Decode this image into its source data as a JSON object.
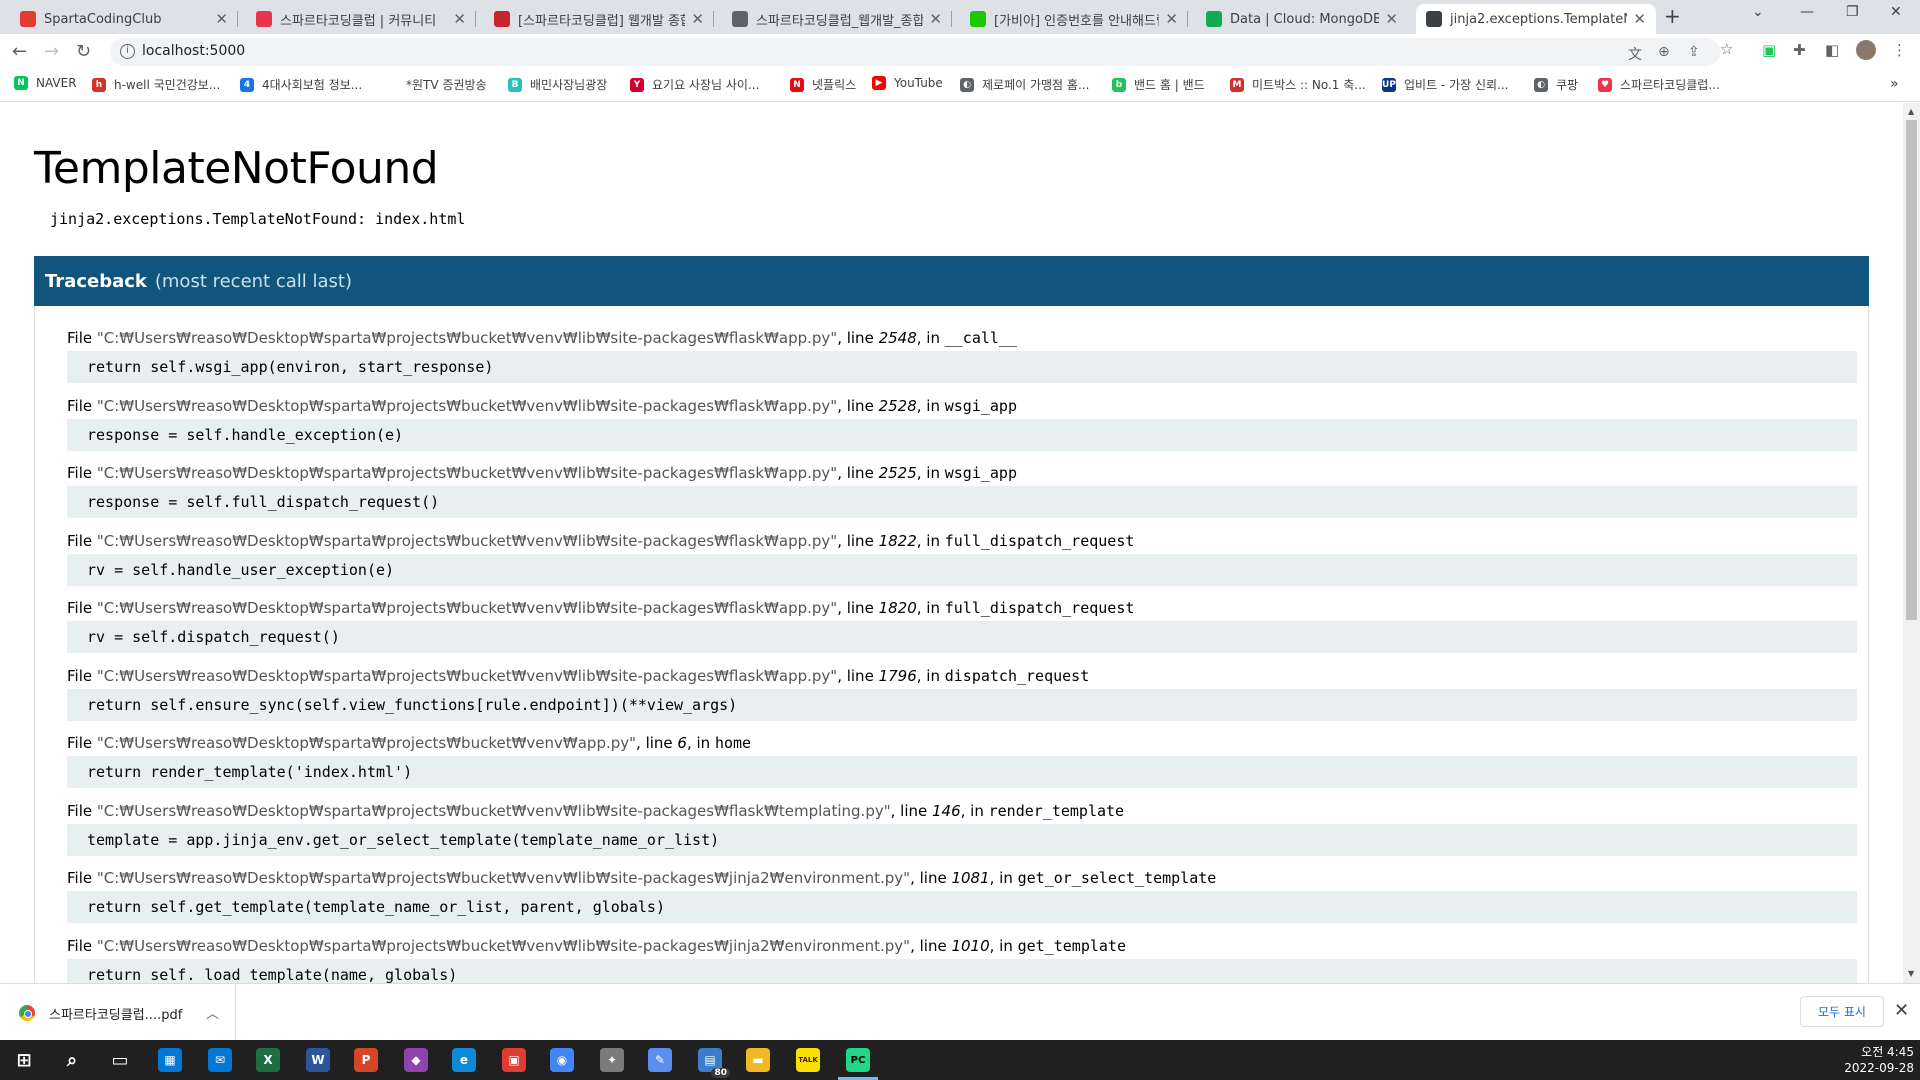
{
  "tabs": [
    {
      "label": "SpartaCodingClub",
      "favicon": "sparta-logo-icon",
      "color": "#e03c31",
      "active": false
    },
    {
      "label": "스파르타코딩클럽 | 커뮤니티",
      "favicon": "sparta-heart-icon",
      "color": "#e8344e",
      "active": false
    },
    {
      "label": "[스파르타코딩클럽] 웹개발 종합",
      "favicon": "notebook-icon",
      "color": "#c4262e",
      "active": false
    },
    {
      "label": "스파르타코딩클럽_웹개발_종합",
      "favicon": "globe-icon",
      "color": "#5f6368",
      "active": false
    },
    {
      "label": "[가비아] 인증번호를 안내해드립",
      "favicon": "mail-icon",
      "color": "#1ec800",
      "active": false
    },
    {
      "label": "Data | Cloud: MongoDB Cloud",
      "favicon": "mongodb-leaf-icon",
      "color": "#13aa52",
      "active": false
    },
    {
      "label": "jinja2.exceptions.TemplateNotF",
      "favicon": "terminal-icon",
      "color": "#3c4043",
      "active": true
    }
  ],
  "toolbar": {
    "url": "localhost:5000"
  },
  "bookmarks": [
    {
      "label": "NAVER",
      "icon": "naver-icon",
      "color": "#03c75a",
      "glyph": "N"
    },
    {
      "label": "h-well 국민건강보...",
      "icon": "hwell-icon",
      "color": "#d93025",
      "glyph": "h"
    },
    {
      "label": "4대사회보험 정보...",
      "icon": "insurance-icon",
      "color": "#1a73e8",
      "glyph": "4"
    },
    {
      "label": "*원TV 증권방송",
      "icon": "",
      "color": "",
      "glyph": ""
    },
    {
      "label": "배민사장님광장",
      "icon": "baemin-icon",
      "color": "#2ac1bc",
      "glyph": "B"
    },
    {
      "label": "요기요 사장님 사이...",
      "icon": "calendar-icon",
      "color": "#d3002d",
      "glyph": "Y"
    },
    {
      "label": "넷플릭스",
      "icon": "netflix-icon",
      "color": "#e50914",
      "glyph": "N"
    },
    {
      "label": "YouTube",
      "icon": "youtube-icon",
      "color": "#ff0000",
      "glyph": "▶"
    },
    {
      "label": "제로페이 가맹점 홈...",
      "icon": "globe-icon",
      "color": "#5f6368",
      "glyph": "◐"
    },
    {
      "label": "밴드 홈 | 밴드",
      "icon": "band-icon",
      "color": "#21c45b",
      "glyph": "b"
    },
    {
      "label": "미트박스 :: No.1 축...",
      "icon": "meatbox-icon",
      "color": "#d32f2f",
      "glyph": "M"
    },
    {
      "label": "업비트 - 가장 신뢰...",
      "icon": "upbit-icon",
      "color": "#093687",
      "glyph": "UP"
    },
    {
      "label": "쿠팡",
      "icon": "globe-icon",
      "color": "#5f6368",
      "glyph": "◐"
    },
    {
      "label": "스파르타코딩클럽...",
      "icon": "sparta-heart-icon",
      "color": "#e8344e",
      "glyph": "♥"
    }
  ],
  "error": {
    "title": "TemplateNotFound",
    "message": "jinja2.exceptions.TemplateNotFound: index.html"
  },
  "traceback": {
    "heading": "Traceback",
    "subheading": "(most recent call last)",
    "frames": [
      {
        "file": "\"C:₩Users₩reaso₩Desktop₩sparta₩projects₩bucket₩venv₩lib₩site-packages₩flask₩app.py\"",
        "line": "2548",
        "func": "__call__",
        "code": "return self.wsgi_app(environ, start_response)"
      },
      {
        "file": "\"C:₩Users₩reaso₩Desktop₩sparta₩projects₩bucket₩venv₩lib₩site-packages₩flask₩app.py\"",
        "line": "2528",
        "func": "wsgi_app",
        "code": "response = self.handle_exception(e)"
      },
      {
        "file": "\"C:₩Users₩reaso₩Desktop₩sparta₩projects₩bucket₩venv₩lib₩site-packages₩flask₩app.py\"",
        "line": "2525",
        "func": "wsgi_app",
        "code": "response = self.full_dispatch_request()"
      },
      {
        "file": "\"C:₩Users₩reaso₩Desktop₩sparta₩projects₩bucket₩venv₩lib₩site-packages₩flask₩app.py\"",
        "line": "1822",
        "func": "full_dispatch_request",
        "code": "rv = self.handle_user_exception(e)"
      },
      {
        "file": "\"C:₩Users₩reaso₩Desktop₩sparta₩projects₩bucket₩venv₩lib₩site-packages₩flask₩app.py\"",
        "line": "1820",
        "func": "full_dispatch_request",
        "code": "rv = self.dispatch_request()"
      },
      {
        "file": "\"C:₩Users₩reaso₩Desktop₩sparta₩projects₩bucket₩venv₩lib₩site-packages₩flask₩app.py\"",
        "line": "1796",
        "func": "dispatch_request",
        "code": "return self.ensure_sync(self.view_functions[rule.endpoint])(**view_args)"
      },
      {
        "file": "\"C:₩Users₩reaso₩Desktop₩sparta₩projects₩bucket₩venv₩app.py\"",
        "line": "6",
        "func": "home",
        "code": "return render_template('index.html')"
      },
      {
        "file": "\"C:₩Users₩reaso₩Desktop₩sparta₩projects₩bucket₩venv₩lib₩site-packages₩flask₩templating.py\"",
        "line": "146",
        "func": "render_template",
        "code": "template = app.jinja_env.get_or_select_template(template_name_or_list)"
      },
      {
        "file": "\"C:₩Users₩reaso₩Desktop₩sparta₩projects₩bucket₩venv₩lib₩site-packages₩jinja2₩environment.py\"",
        "line": "1081",
        "func": "get_or_select_template",
        "code": "return self.get_template(template_name_or_list, parent, globals)"
      },
      {
        "file": "\"C:₩Users₩reaso₩Desktop₩sparta₩projects₩bucket₩venv₩lib₩site-packages₩jinja2₩environment.py\"",
        "line": "1010",
        "func": "get_template",
        "code": "return self._load_template(name, globals)"
      }
    ],
    "file_prefix": "File ",
    "line_prefix": ", line ",
    "in_prefix": ", in "
  },
  "download": {
    "filename": "스파르타코딩클럽....pdf",
    "show_all": "모두 표시"
  },
  "taskbar": {
    "time": "오전 4:45",
    "date": "2022-09-28",
    "badge": "80",
    "apps": [
      {
        "name": "windows-start-icon",
        "color": "#202020",
        "glyph": "⊞"
      },
      {
        "name": "search-icon",
        "color": "#202020",
        "glyph": "⌕"
      },
      {
        "name": "task-view-icon",
        "color": "#202020",
        "glyph": "▭"
      },
      {
        "name": "store-icon",
        "color": "#0078d4",
        "glyph": "▦"
      },
      {
        "name": "mail-app-icon",
        "color": "#0078d4",
        "glyph": "✉"
      },
      {
        "name": "excel-icon",
        "color": "#1d6f42",
        "glyph": "X"
      },
      {
        "name": "word-icon",
        "color": "#2b579a",
        "glyph": "W"
      },
      {
        "name": "powerpoint-icon",
        "color": "#d24726",
        "glyph": "P"
      },
      {
        "name": "color-drop-icon",
        "color": "#8e44ad",
        "glyph": "◆"
      },
      {
        "name": "edge-icon",
        "color": "#0c8ad8",
        "glyph": "e"
      },
      {
        "name": "notebook-app-icon",
        "color": "#e03c31",
        "glyph": "▣"
      },
      {
        "name": "chrome-icon",
        "color": "#4285f4",
        "glyph": "◉"
      },
      {
        "name": "app-icon-a",
        "color": "#7b7b7b",
        "glyph": "✦"
      },
      {
        "name": "paint-icon",
        "color": "#5a8dee",
        "glyph": "✎"
      },
      {
        "name": "messenger-icon",
        "color": "#3d7cc9",
        "glyph": "▤"
      },
      {
        "name": "file-explorer-icon",
        "color": "#f2b824",
        "glyph": "▬"
      },
      {
        "name": "kakaotalk-icon",
        "color": "#f9e000",
        "glyph": "TALK"
      },
      {
        "name": "pycharm-icon",
        "color": "#21d789",
        "glyph": "PC"
      }
    ]
  }
}
